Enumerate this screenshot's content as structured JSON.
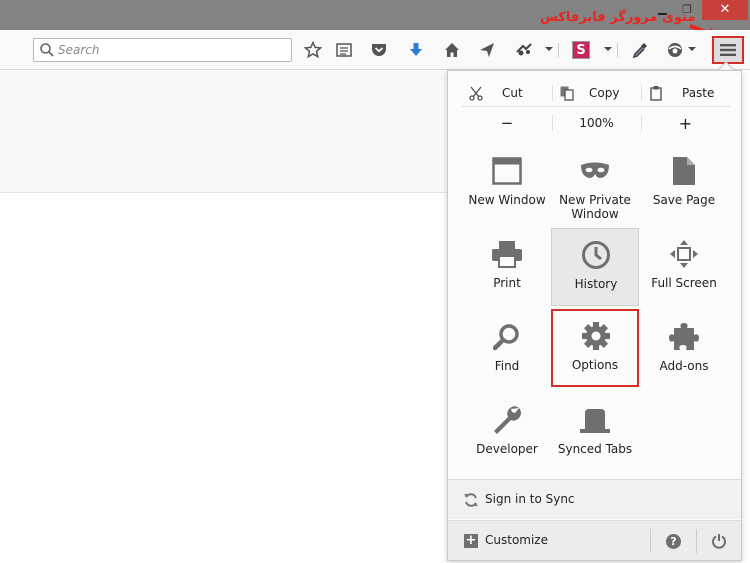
{
  "titlebar": {
    "restore_glyph": "❐",
    "close_glyph": "✕",
    "annotation": "منوی مرورگر فایرفاکس"
  },
  "toolbar": {
    "search_placeholder": "Search",
    "icons": [
      "star-icon",
      "reading-list-icon",
      "pocket-icon",
      "downloads-icon",
      "home-icon",
      "share-icon",
      "extension-icon",
      "s-extension-icon",
      "eyedropper-icon",
      "identity-icon",
      "hamburger-menu-icon"
    ],
    "s_extension_letter": "S"
  },
  "menu": {
    "edit": {
      "cut": "Cut",
      "copy": "Copy",
      "paste": "Paste"
    },
    "zoom": {
      "out": "−",
      "level": "100%",
      "in": "+"
    },
    "items": {
      "new_window": "New Window",
      "new_private_window_1": "New Private",
      "new_private_window_2": "Window",
      "save_page": "Save Page",
      "print": "Print",
      "history": "History",
      "full_screen": "Full Screen",
      "find": "Find",
      "options": "Options",
      "addons": "Add-ons",
      "developer": "Developer",
      "synced_tabs": "Synced Tabs"
    },
    "sync": "Sign in to Sync",
    "customize": "Customize"
  },
  "colors": {
    "highlight": "#d42e2a",
    "titlebar": "#838383",
    "icon_gray": "#6f6f6f",
    "download_blue": "#2a7cd4",
    "s_extension": "#c8255b"
  }
}
